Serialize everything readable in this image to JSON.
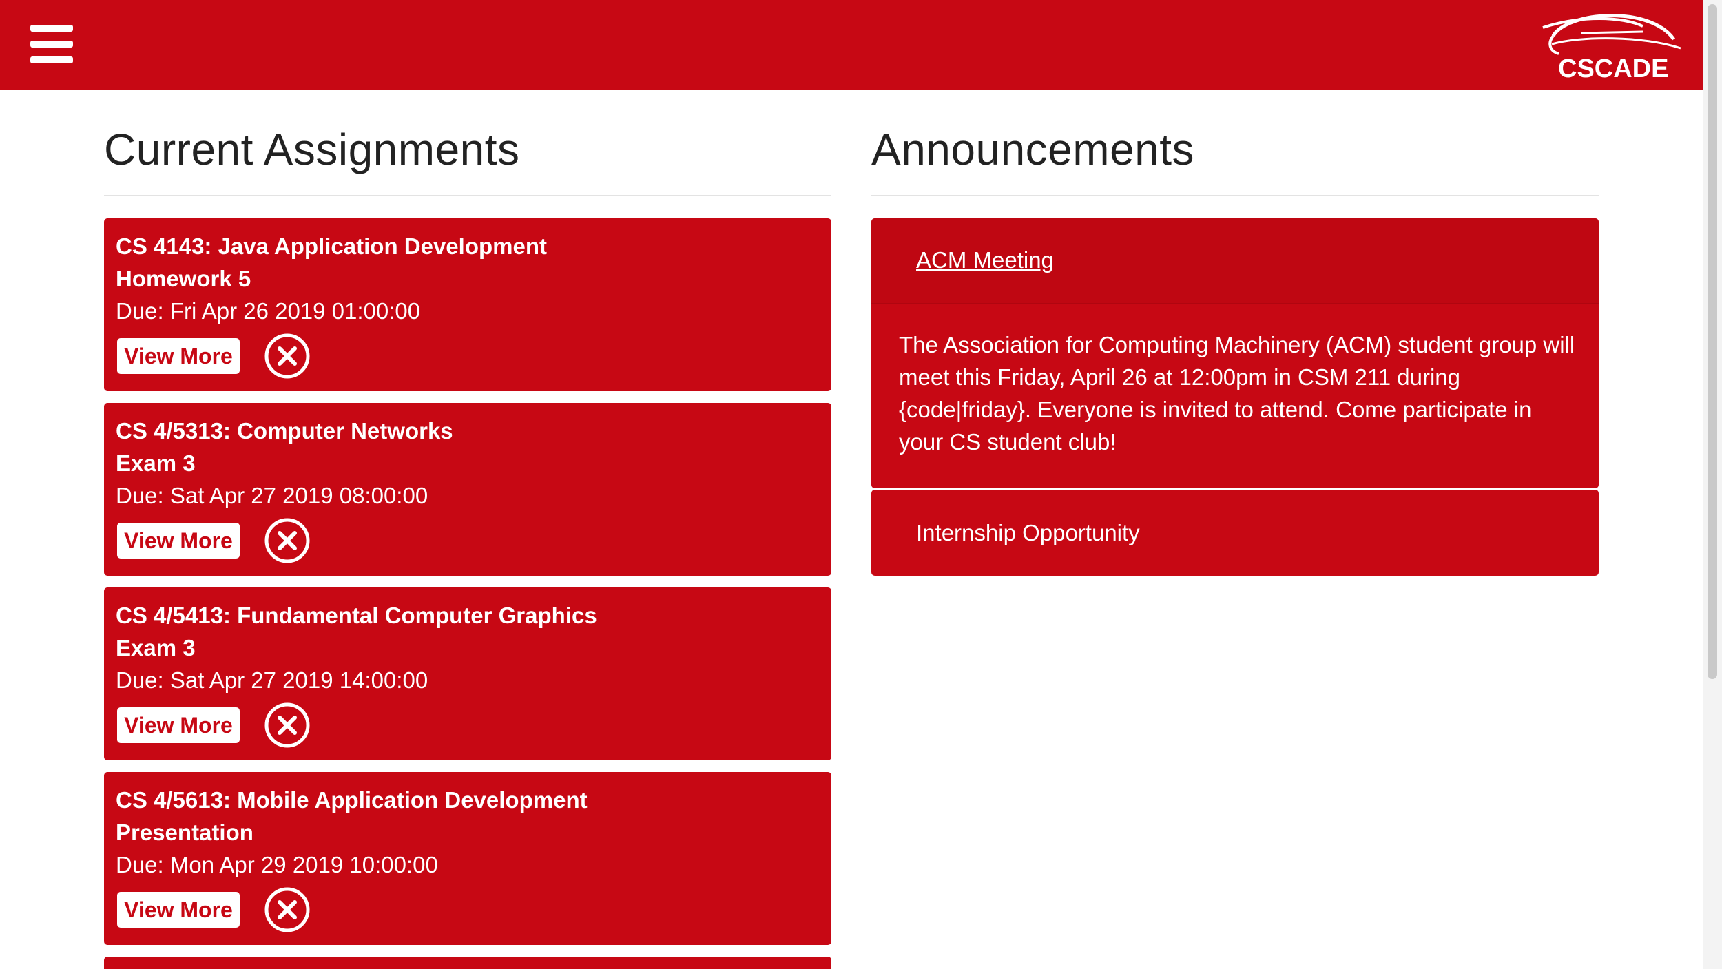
{
  "header": {
    "menu_icon": "hamburger-menu-icon",
    "logo_text": "CSCADE",
    "brand_color": "#c70814"
  },
  "assignments": {
    "title": "Current Assignments",
    "view_more_label": "View More",
    "remove_icon": "circle-x-icon",
    "items": [
      {
        "course": "CS 4143: Java Application Development",
        "name": "Homework 5",
        "due": "Due: Fri Apr 26 2019 01:00:00"
      },
      {
        "course": "CS 4/5313: Computer Networks",
        "name": "Exam 3",
        "due": "Due: Sat Apr 27 2019 08:00:00"
      },
      {
        "course": "CS 4/5413: Fundamental Computer Graphics",
        "name": "Exam 3",
        "due": "Due: Sat Apr 27 2019 14:00:00"
      },
      {
        "course": "CS 4/5613: Mobile Application Development",
        "name": "Presentation",
        "due": "Due: Mon Apr 29 2019 10:00:00"
      }
    ]
  },
  "announcements": {
    "title": "Announcements",
    "items": [
      {
        "title": "ACM Meeting",
        "body": "The Association for Computing Machinery (ACM) student group will meet this Friday, April 26 at 12:00pm in CSM 211 during {code|friday}. Everyone is invited to attend. Come participate in your CS student club!"
      },
      {
        "title": "Internship Opportunity"
      }
    ]
  }
}
